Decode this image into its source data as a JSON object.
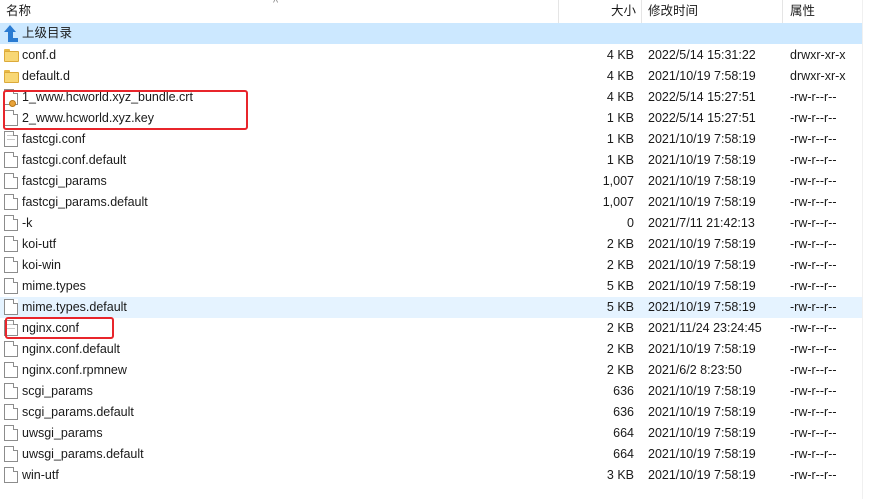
{
  "header": {
    "name": "名称",
    "size": "大小",
    "modified": "修改时间",
    "attributes": "属性",
    "sort_indicator": "^"
  },
  "parent": {
    "label": "上级目录",
    "icon": "up-arrow-icon"
  },
  "colors": {
    "highlight_box": "#e8252b",
    "selection": "#cce8ff",
    "hover": "#e5f3ff"
  },
  "files": [
    {
      "name": "conf.d",
      "size": "4 KB",
      "modified": "2022/5/14 15:31:22",
      "attr": "drwxr-xr-x",
      "type": "folder"
    },
    {
      "name": "default.d",
      "size": "4 KB",
      "modified": "2021/10/19 7:58:19",
      "attr": "drwxr-xr-x",
      "type": "folder"
    },
    {
      "name": "1_www.hcworld.xyz_bundle.crt",
      "size": "4 KB",
      "modified": "2022/5/14 15:27:51",
      "attr": "-rw-r--r--",
      "type": "cert"
    },
    {
      "name": "2_www.hcworld.xyz.key",
      "size": "1 KB",
      "modified": "2022/5/14 15:27:51",
      "attr": "-rw-r--r--",
      "type": "file"
    },
    {
      "name": "fastcgi.conf",
      "size": "1 KB",
      "modified": "2021/10/19 7:58:19",
      "attr": "-rw-r--r--",
      "type": "text"
    },
    {
      "name": "fastcgi.conf.default",
      "size": "1 KB",
      "modified": "2021/10/19 7:58:19",
      "attr": "-rw-r--r--",
      "type": "file"
    },
    {
      "name": "fastcgi_params",
      "size": "1,007",
      "modified": "2021/10/19 7:58:19",
      "attr": "-rw-r--r--",
      "type": "file"
    },
    {
      "name": "fastcgi_params.default",
      "size": "1,007",
      "modified": "2021/10/19 7:58:19",
      "attr": "-rw-r--r--",
      "type": "file"
    },
    {
      "name": "-k",
      "size": "0",
      "modified": "2021/7/11 21:42:13",
      "attr": "-rw-r--r--",
      "type": "file"
    },
    {
      "name": "koi-utf",
      "size": "2 KB",
      "modified": "2021/10/19 7:58:19",
      "attr": "-rw-r--r--",
      "type": "file"
    },
    {
      "name": "koi-win",
      "size": "2 KB",
      "modified": "2021/10/19 7:58:19",
      "attr": "-rw-r--r--",
      "type": "file"
    },
    {
      "name": "mime.types",
      "size": "5 KB",
      "modified": "2021/10/19 7:58:19",
      "attr": "-rw-r--r--",
      "type": "file"
    },
    {
      "name": "mime.types.default",
      "size": "5 KB",
      "modified": "2021/10/19 7:58:19",
      "attr": "-rw-r--r--",
      "type": "file"
    },
    {
      "name": "nginx.conf",
      "size": "2 KB",
      "modified": "2021/11/24 23:24:45",
      "attr": "-rw-r--r--",
      "type": "text"
    },
    {
      "name": "nginx.conf.default",
      "size": "2 KB",
      "modified": "2021/10/19 7:58:19",
      "attr": "-rw-r--r--",
      "type": "file"
    },
    {
      "name": "nginx.conf.rpmnew",
      "size": "2 KB",
      "modified": "2021/6/2 8:23:50",
      "attr": "-rw-r--r--",
      "type": "file"
    },
    {
      "name": "scgi_params",
      "size": "636",
      "modified": "2021/10/19 7:58:19",
      "attr": "-rw-r--r--",
      "type": "file"
    },
    {
      "name": "scgi_params.default",
      "size": "636",
      "modified": "2021/10/19 7:58:19",
      "attr": "-rw-r--r--",
      "type": "file"
    },
    {
      "name": "uwsgi_params",
      "size": "664",
      "modified": "2021/10/19 7:58:19",
      "attr": "-rw-r--r--",
      "type": "file"
    },
    {
      "name": "uwsgi_params.default",
      "size": "664",
      "modified": "2021/10/19 7:58:19",
      "attr": "-rw-r--r--",
      "type": "file"
    },
    {
      "name": "win-utf",
      "size": "3 KB",
      "modified": "2021/10/19 7:58:19",
      "attr": "-rw-r--r--",
      "type": "file"
    }
  ]
}
